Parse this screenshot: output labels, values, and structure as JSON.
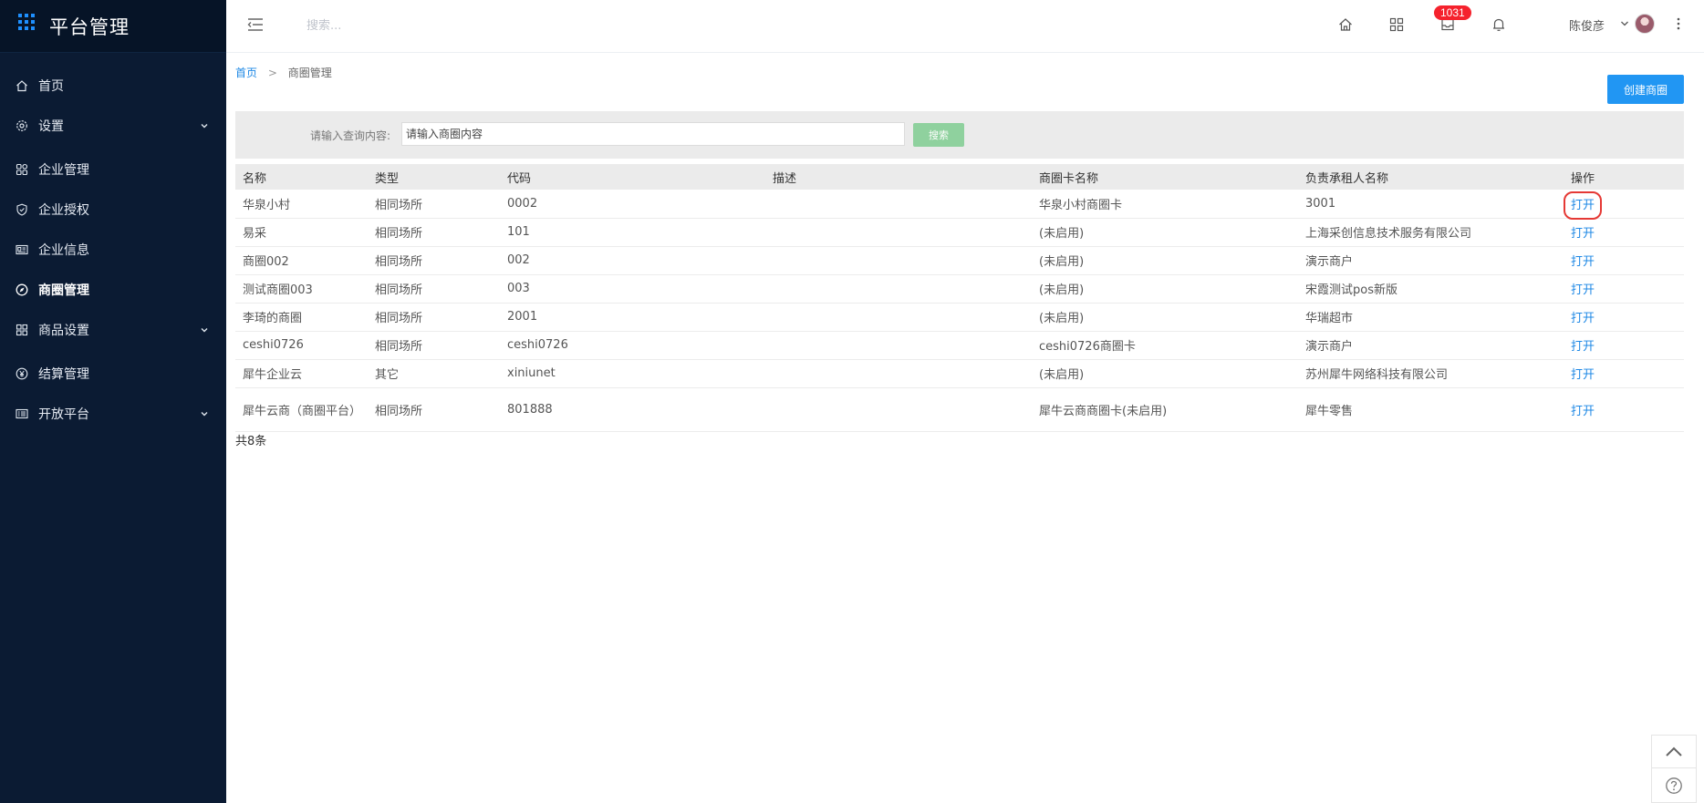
{
  "sidebar": {
    "title": "平台管理",
    "items": [
      {
        "label": "首页",
        "icon": "home-icon"
      },
      {
        "label": "设置",
        "icon": "gear-icon",
        "expandable": true
      },
      {
        "label": "企业管理",
        "icon": "apps-icon"
      },
      {
        "label": "企业授权",
        "icon": "shield-check-icon"
      },
      {
        "label": "企业信息",
        "icon": "id-card-icon"
      },
      {
        "label": "商圈管理",
        "icon": "compass-icon",
        "active": true
      },
      {
        "label": "商品设置",
        "icon": "grid-icon",
        "expandable": true
      },
      {
        "label": "结算管理",
        "icon": "yen-circle-icon"
      },
      {
        "label": "开放平台",
        "icon": "list-card-icon",
        "expandable": true
      }
    ]
  },
  "topbar": {
    "search_placeholder": "搜索...",
    "badge_count": "1031",
    "user_name": "陈俊彦"
  },
  "breadcrumb": {
    "home": "首页",
    "separator": ">",
    "current": "商圈管理"
  },
  "toolbar": {
    "create_label": "创建商圈"
  },
  "filter": {
    "label": "请输入查询内容:",
    "placeholder": "请输入商圈内容",
    "search_label": "搜索"
  },
  "table": {
    "columns": [
      "名称",
      "类型",
      "代码",
      "描述",
      "商圈卡名称",
      "负责承租人名称",
      "操作"
    ],
    "rows": [
      {
        "name": "华泉小村",
        "type": "相同场所",
        "code": "0002",
        "desc": "",
        "card": "华泉小村商圈卡",
        "tenant": "3001",
        "action": "打开"
      },
      {
        "name": "易采",
        "type": "相同场所",
        "code": "101",
        "desc": "",
        "card": "(未启用)",
        "tenant": "上海采创信息技术服务有限公司",
        "action": "打开"
      },
      {
        "name": "商圈002",
        "type": "相同场所",
        "code": "002",
        "desc": "",
        "card": "(未启用)",
        "tenant": "演示商户",
        "action": "打开"
      },
      {
        "name": "测试商圈003",
        "type": "相同场所",
        "code": "003",
        "desc": "",
        "card": "(未启用)",
        "tenant": "宋霞测试pos新版",
        "action": "打开"
      },
      {
        "name": "李琦的商圈",
        "type": "相同场所",
        "code": "2001",
        "desc": "",
        "card": "(未启用)",
        "tenant": "华瑞超市",
        "action": "打开"
      },
      {
        "name": "ceshi0726",
        "type": "相同场所",
        "code": "ceshi0726",
        "desc": "",
        "card": "ceshi0726商圈卡",
        "tenant": "演示商户",
        "action": "打开"
      },
      {
        "name": "犀牛企业云",
        "type": "其它",
        "code": "xiniunet",
        "desc": "",
        "card": "(未启用)",
        "tenant": "苏州犀牛网络科技有限公司",
        "action": "打开"
      },
      {
        "name": "犀牛云商（商圈平台）",
        "type": "相同场所",
        "code": "801888",
        "desc": "",
        "card": "犀牛云商商圈卡(未启用)",
        "tenant": "犀牛零售",
        "action": "打开"
      }
    ],
    "total": "共8条"
  },
  "colors": {
    "sidebar_bg": "#0b1b33",
    "accent": "#2196f3",
    "link": "#1e88e5",
    "search_button": "#8fd19e",
    "badge": "#f5222d",
    "highlight": "#e53935"
  }
}
